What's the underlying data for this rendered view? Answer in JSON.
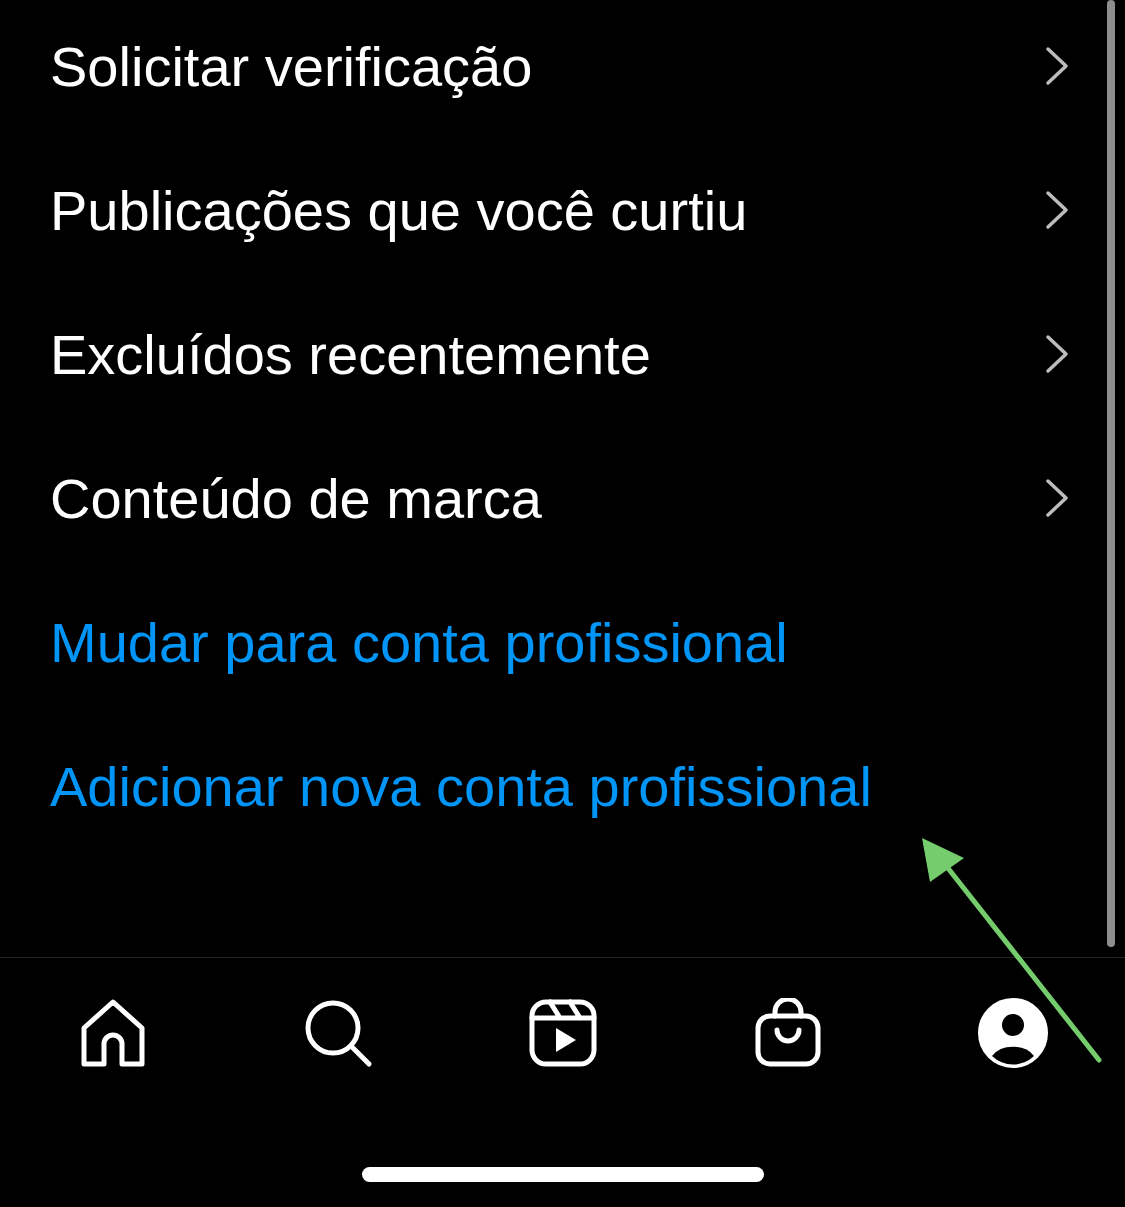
{
  "menu_items": [
    {
      "label": "Solicitar verificação",
      "kind": "chevron"
    },
    {
      "label": "Publicações que você curtiu",
      "kind": "chevron"
    },
    {
      "label": "Excluídos recentemente",
      "kind": "chevron"
    },
    {
      "label": "Conteúdo de marca",
      "kind": "chevron"
    },
    {
      "label": "Mudar para conta profissional",
      "kind": "link"
    },
    {
      "label": "Adicionar nova conta profissional",
      "kind": "link"
    }
  ],
  "tab_bar": [
    {
      "kind": "home",
      "selected": false
    },
    {
      "kind": "search",
      "selected": false
    },
    {
      "kind": "reels",
      "selected": false
    },
    {
      "kind": "shop",
      "selected": false
    },
    {
      "kind": "profile",
      "selected": true
    }
  ]
}
